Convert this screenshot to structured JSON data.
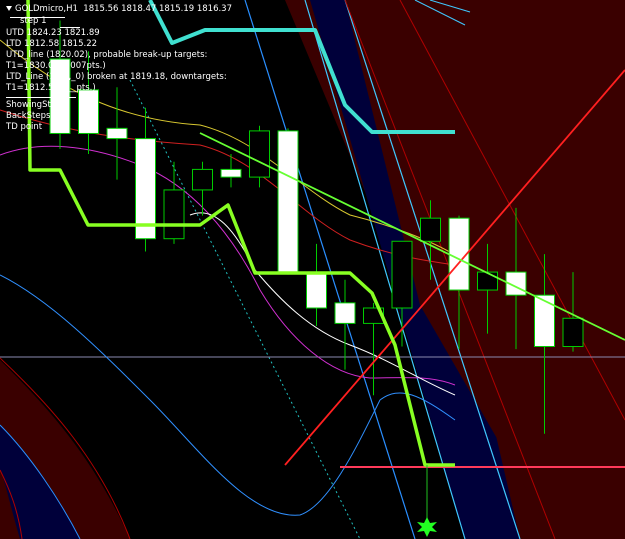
{
  "header": {
    "symbol_label": "GOLDmicro,H1",
    "ohlc": "1815.56 1818.47 1815.19 1816.37"
  },
  "indicator_label": "step 1",
  "text_lines": [
    "UTD 1824.23 1821.89",
    "LTD 1812.58 1815.22",
    "UTD_line (1820.02), probable break-up targets:",
    "T1=1830.08 (1007pts.)",
    "LTD_Line (18__,_0) broken at 1819.18, downtargets:",
    "T1=1812.5__ (__pts.)"
  ],
  "panel_lines": [
    "ShowingSt__",
    "BackSteps=__",
    "TD point"
  ],
  "colors": {
    "background": "#000000",
    "bull_candle": "#000000",
    "bear_candle": "#ffffff",
    "candle_border": "#00cc00",
    "trend_green": "#7cfc00",
    "trend_cyan": "#40e0d0",
    "td_line_red": "#ff2020",
    "td_line_green": "#66ff33",
    "channel_dark_red": "#3a0000",
    "channel_navy": "#00003a"
  },
  "chart_data": {
    "type": "candlestick",
    "symbol": "GOLDmicro",
    "timeframe": "H1",
    "title": "GOLDmicro,H1",
    "price_range": [
      1807,
      1828
    ],
    "grid": false,
    "current_price": 1816.37,
    "candles": [
      {
        "i": 0,
        "open": 1825.7,
        "high": 1827.2,
        "low": 1822.2,
        "close": 1822.8
      },
      {
        "i": 1,
        "open": 1824.5,
        "high": 1826.0,
        "low": 1822.0,
        "close": 1822.8
      },
      {
        "i": 2,
        "open": 1823.0,
        "high": 1824.6,
        "low": 1821.0,
        "close": 1822.6
      },
      {
        "i": 3,
        "open": 1822.6,
        "high": 1823.8,
        "low": 1818.2,
        "close": 1818.7
      },
      {
        "i": 4,
        "open": 1818.7,
        "high": 1821.7,
        "low": 1818.5,
        "close": 1820.6
      },
      {
        "i": 5,
        "open": 1820.6,
        "high": 1821.7,
        "low": 1819.6,
        "close": 1821.4
      },
      {
        "i": 6,
        "open": 1821.4,
        "high": 1822.0,
        "low": 1820.7,
        "close": 1821.1
      },
      {
        "i": 7,
        "open": 1821.1,
        "high": 1823.1,
        "low": 1820.7,
        "close": 1822.9
      },
      {
        "i": 8,
        "open": 1822.9,
        "high": 1823.0,
        "low": 1817.3,
        "close": 1817.4
      },
      {
        "i": 9,
        "open": 1817.4,
        "high": 1818.5,
        "low": 1815.3,
        "close": 1816.0
      },
      {
        "i": 10,
        "open": 1816.2,
        "high": 1817.1,
        "low": 1813.6,
        "close": 1815.4
      },
      {
        "i": 11,
        "open": 1815.4,
        "high": 1816.2,
        "low": 1812.6,
        "close": 1816.0
      },
      {
        "i": 12,
        "open": 1816.0,
        "high": 1818.6,
        "low": 1814.5,
        "close": 1818.6
      },
      {
        "i": 13,
        "open": 1818.6,
        "high": 1820.2,
        "low": 1817.1,
        "close": 1819.5
      },
      {
        "i": 14,
        "open": 1819.5,
        "high": 1819.6,
        "low": 1814.4,
        "close": 1816.7
      },
      {
        "i": 15,
        "open": 1816.7,
        "high": 1818.5,
        "low": 1815.0,
        "close": 1817.4
      },
      {
        "i": 16,
        "open": 1817.4,
        "high": 1819.9,
        "low": 1814.4,
        "close": 1816.5
      },
      {
        "i": 17,
        "open": 1816.5,
        "high": 1818.1,
        "low": 1811.1,
        "close": 1814.5
      },
      {
        "i": 18,
        "open": 1814.5,
        "high": 1817.4,
        "low": 1814.3,
        "close": 1815.6
      }
    ],
    "horizontal_levels": [
      1815.22,
      1812.58
    ],
    "annotations": [
      "TD point"
    ]
  }
}
